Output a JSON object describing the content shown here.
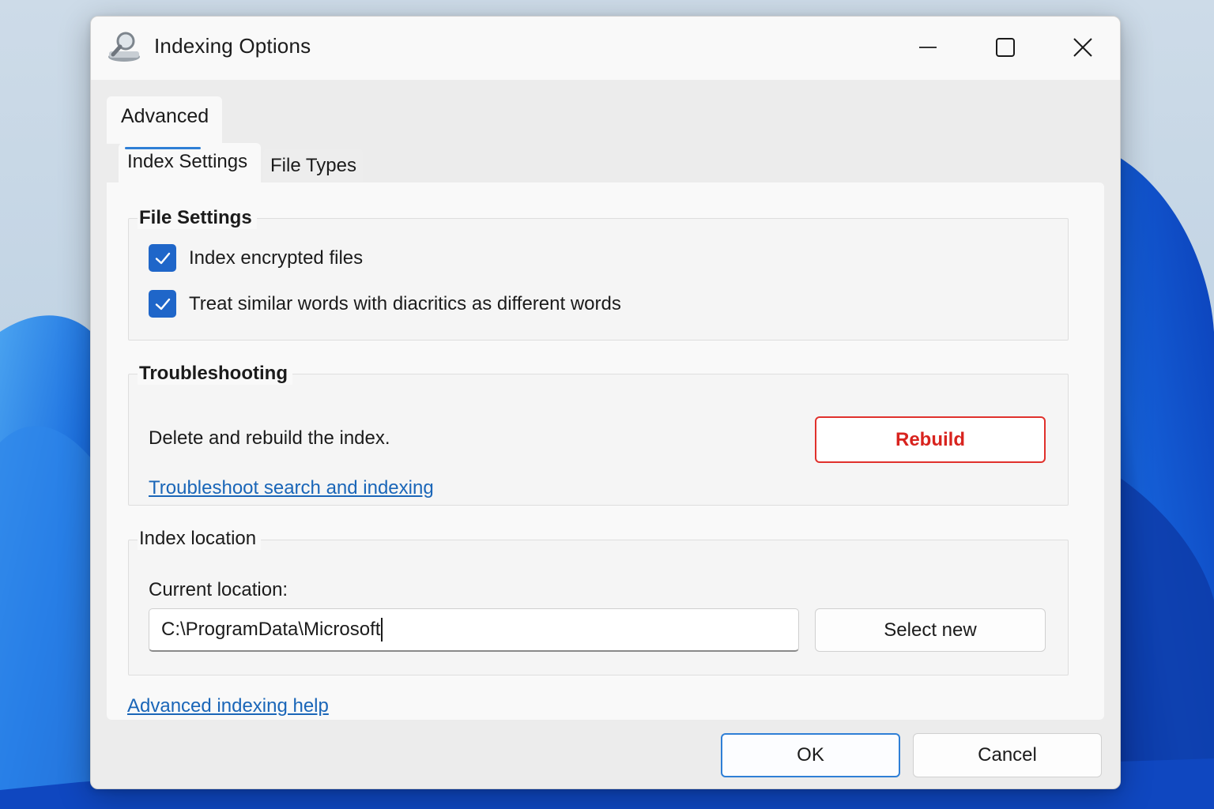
{
  "window": {
    "title": "Indexing Options",
    "icon": "indexing-options-icon"
  },
  "title_buttons": {
    "minimize_icon": "minimize-icon",
    "maximize_icon": "maximize-icon",
    "close_icon": "close-icon"
  },
  "tabs": {
    "top": "Advanced",
    "items": [
      {
        "label": "Index Settings",
        "selected": true
      },
      {
        "label": "File Types",
        "selected": false
      }
    ]
  },
  "file_settings": {
    "title": "File Settings",
    "options": [
      {
        "label": "Index encrypted files",
        "checked": true
      },
      {
        "label": "Treat similar words with diacritics as different words",
        "checked": true
      }
    ]
  },
  "troubleshooting": {
    "title": "Troubleshooting",
    "description": "Delete and rebuild the index.",
    "rebuild_label": "Rebuild",
    "link": "Troubleshoot search and indexing"
  },
  "index_location": {
    "title": "Index location",
    "current_label": "Current location:",
    "current_value": "C:\\ProgramData\\Microsoft",
    "select_label": "Select new"
  },
  "help_link": "Advanced indexing help",
  "footer": {
    "ok_label": "OK",
    "cancel_label": "Cancel"
  },
  "colors": {
    "accent": "#1f66c9",
    "link": "#1a66b8",
    "danger": "#e0312c",
    "wallpaper_blue": "#1f5fd6"
  }
}
